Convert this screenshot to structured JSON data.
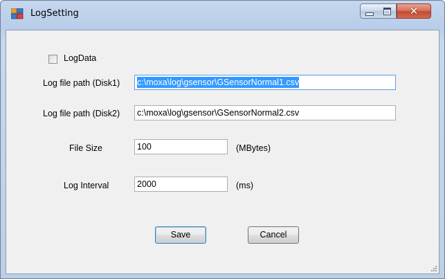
{
  "window": {
    "title": "LogSetting",
    "controls": {
      "minimize": "minimize",
      "maximize": "maximize",
      "close": "close"
    },
    "colors": {
      "frame": "#b8cde9",
      "client": "#f0f0f0",
      "selection": "#3399ff",
      "close_button": "#c44a33"
    }
  },
  "form": {
    "log_data": {
      "label": "LogData",
      "checked": false
    },
    "disk1": {
      "label": "Log file path (Disk1)",
      "value": "c:\\moxa\\log\\gsensor\\GSensorNormal1.csv"
    },
    "disk2": {
      "label": "Log file path (Disk2)",
      "value": "c:\\moxa\\log\\gsensor\\GSensorNormal2.csv"
    },
    "file_size": {
      "label": "File Size",
      "value": "100",
      "unit": "(MBytes)"
    },
    "log_interval": {
      "label": "Log Interval",
      "value": "2000",
      "unit": "(ms)"
    }
  },
  "buttons": {
    "save": "Save",
    "cancel": "Cancel"
  },
  "icons": {
    "app": "app-window-icon",
    "resize": "resize-grip-icon"
  }
}
